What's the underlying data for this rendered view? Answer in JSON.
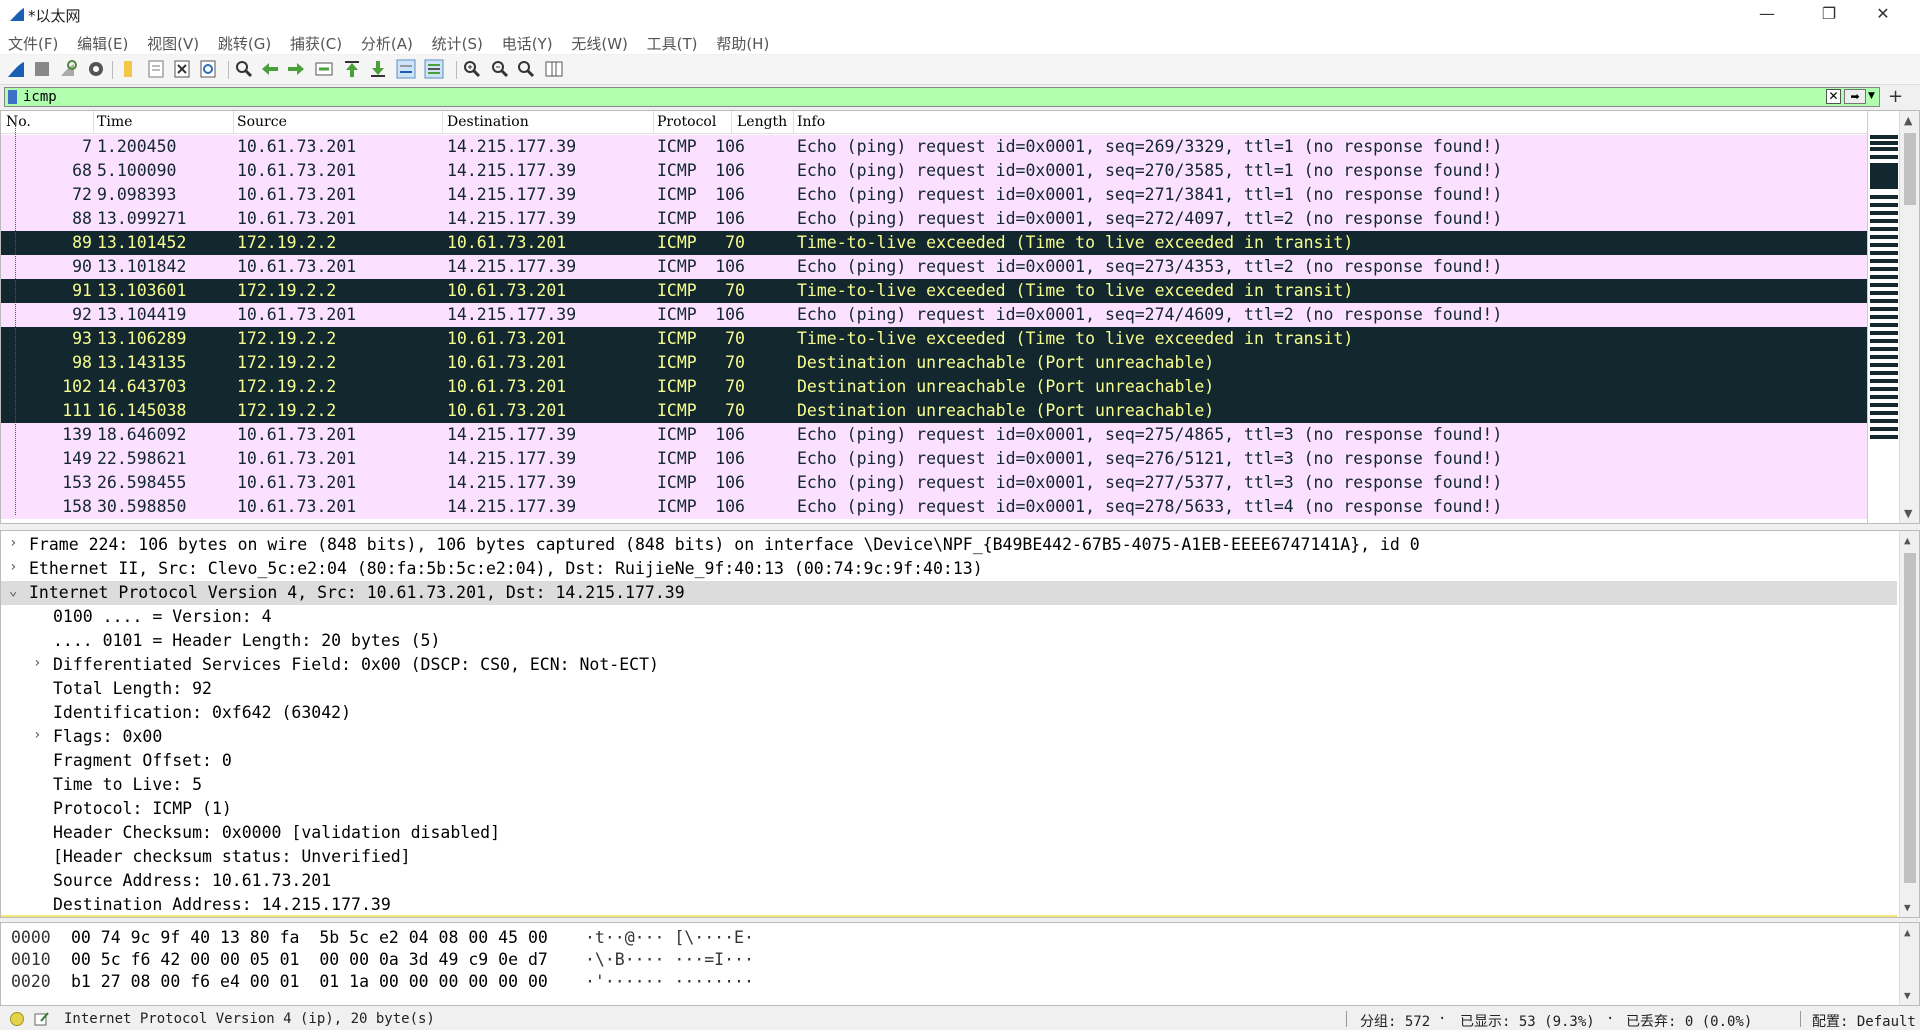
{
  "window": {
    "title": "*以太网",
    "minimize": "—",
    "maximize": "❐",
    "close": "✕"
  },
  "menu": [
    "文件(F)",
    "编辑(E)",
    "视图(V)",
    "跳转(G)",
    "捕获(C)",
    "分析(A)",
    "统计(S)",
    "电话(Y)",
    "无线(W)",
    "工具(T)",
    "帮助(H)"
  ],
  "toolbar_icons": [
    "shark-fin-start-icon",
    "stop-icon",
    "restart-icon",
    "capture-options-icon",
    "open-folder-icon",
    "save-file-icon",
    "close-file-icon",
    "reload-icon",
    "find-icon",
    "go-back-icon",
    "go-forward-icon",
    "go-to-packet-icon",
    "go-first-icon",
    "go-last-icon",
    "autoscroll-icon",
    "colorize-icon",
    "zoom-in-icon",
    "zoom-out-icon",
    "zoom-reset-icon",
    "resize-columns-icon"
  ],
  "filter": {
    "value": "icmp"
  },
  "columns": {
    "no": "No.",
    "time": "Time",
    "source": "Source",
    "destination": "Destination",
    "protocol": "Protocol",
    "length": "Length",
    "info": "Info"
  },
  "packets": [
    {
      "no": "7",
      "time": "1.200450",
      "src": "10.61.73.201",
      "dst": "14.215.177.39",
      "proto": "ICMP",
      "len": "106",
      "info": "Echo (ping) request  id=0x0001, seq=269/3329, ttl=1 (no response found!)",
      "type": "req"
    },
    {
      "no": "68",
      "time": "5.100090",
      "src": "10.61.73.201",
      "dst": "14.215.177.39",
      "proto": "ICMP",
      "len": "106",
      "info": "Echo (ping) request  id=0x0001, seq=270/3585, ttl=1 (no response found!)",
      "type": "req"
    },
    {
      "no": "72",
      "time": "9.098393",
      "src": "10.61.73.201",
      "dst": "14.215.177.39",
      "proto": "ICMP",
      "len": "106",
      "info": "Echo (ping) request  id=0x0001, seq=271/3841, ttl=1 (no response found!)",
      "type": "req"
    },
    {
      "no": "88",
      "time": "13.099271",
      "src": "10.61.73.201",
      "dst": "14.215.177.39",
      "proto": "ICMP",
      "len": "106",
      "info": "Echo (ping) request  id=0x0001, seq=272/4097, ttl=2 (no response found!)",
      "type": "req"
    },
    {
      "no": "89",
      "time": "13.101452",
      "src": "172.19.2.2",
      "dst": "10.61.73.201",
      "proto": "ICMP",
      "len": "70",
      "info": "Time-to-live exceeded (Time to live exceeded in transit)",
      "type": "exc"
    },
    {
      "no": "90",
      "time": "13.101842",
      "src": "10.61.73.201",
      "dst": "14.215.177.39",
      "proto": "ICMP",
      "len": "106",
      "info": "Echo (ping) request  id=0x0001, seq=273/4353, ttl=2 (no response found!)",
      "type": "req"
    },
    {
      "no": "91",
      "time": "13.103601",
      "src": "172.19.2.2",
      "dst": "10.61.73.201",
      "proto": "ICMP",
      "len": "70",
      "info": "Time-to-live exceeded (Time to live exceeded in transit)",
      "type": "exc"
    },
    {
      "no": "92",
      "time": "13.104419",
      "src": "10.61.73.201",
      "dst": "14.215.177.39",
      "proto": "ICMP",
      "len": "106",
      "info": "Echo (ping) request  id=0x0001, seq=274/4609, ttl=2 (no response found!)",
      "type": "req"
    },
    {
      "no": "93",
      "time": "13.106289",
      "src": "172.19.2.2",
      "dst": "10.61.73.201",
      "proto": "ICMP",
      "len": "70",
      "info": "Time-to-live exceeded (Time to live exceeded in transit)",
      "type": "exc"
    },
    {
      "no": "98",
      "time": "13.143135",
      "src": "172.19.2.2",
      "dst": "10.61.73.201",
      "proto": "ICMP",
      "len": "70",
      "info": "Destination unreachable (Port unreachable)",
      "type": "exc"
    },
    {
      "no": "102",
      "time": "14.643703",
      "src": "172.19.2.2",
      "dst": "10.61.73.201",
      "proto": "ICMP",
      "len": "70",
      "info": "Destination unreachable (Port unreachable)",
      "type": "exc"
    },
    {
      "no": "111",
      "time": "16.145038",
      "src": "172.19.2.2",
      "dst": "10.61.73.201",
      "proto": "ICMP",
      "len": "70",
      "info": "Destination unreachable (Port unreachable)",
      "type": "exc"
    },
    {
      "no": "139",
      "time": "18.646092",
      "src": "10.61.73.201",
      "dst": "14.215.177.39",
      "proto": "ICMP",
      "len": "106",
      "info": "Echo (ping) request  id=0x0001, seq=275/4865, ttl=3 (no response found!)",
      "type": "req"
    },
    {
      "no": "149",
      "time": "22.598621",
      "src": "10.61.73.201",
      "dst": "14.215.177.39",
      "proto": "ICMP",
      "len": "106",
      "info": "Echo (ping) request  id=0x0001, seq=276/5121, ttl=3 (no response found!)",
      "type": "req"
    },
    {
      "no": "153",
      "time": "26.598455",
      "src": "10.61.73.201",
      "dst": "14.215.177.39",
      "proto": "ICMP",
      "len": "106",
      "info": "Echo (ping) request  id=0x0001, seq=277/5377, ttl=3 (no response found!)",
      "type": "req"
    },
    {
      "no": "158",
      "time": "30.598850",
      "src": "10.61.73.201",
      "dst": "14.215.177.39",
      "proto": "ICMP",
      "len": "106",
      "info": "Echo (ping) request  id=0x0001, seq=278/5633, ttl=4 (no response found!)",
      "type": "req"
    }
  ],
  "details": [
    {
      "exp": "›",
      "indent": 0,
      "text": "Frame 224: 106 bytes on wire (848 bits), 106 bytes captured (848 bits) on interface \\Device\\NPF_{B49BE442-67B5-4075-A1EB-EEEE6747141A}, id 0"
    },
    {
      "exp": "›",
      "indent": 0,
      "text": "Ethernet II, Src: Clevo_5c:e2:04 (80:fa:5b:5c:e2:04), Dst: RuijieNe_9f:40:13 (00:74:9c:9f:40:13)"
    },
    {
      "exp": "⌄",
      "indent": 0,
      "text": "Internet Protocol Version 4, Src: 10.61.73.201, Dst: 14.215.177.39",
      "selected": true
    },
    {
      "exp": "",
      "indent": 1,
      "text": "0100 .... = Version: 4"
    },
    {
      "exp": "",
      "indent": 1,
      "text": ".... 0101 = Header Length: 20 bytes (5)"
    },
    {
      "exp": "›",
      "indent": 1,
      "text": "Differentiated Services Field: 0x00 (DSCP: CS0, ECN: Not-ECT)"
    },
    {
      "exp": "",
      "indent": 1,
      "text": "Total Length: 92"
    },
    {
      "exp": "",
      "indent": 1,
      "text": "Identification: 0xf642 (63042)"
    },
    {
      "exp": "›",
      "indent": 1,
      "text": "Flags: 0x00"
    },
    {
      "exp": "",
      "indent": 1,
      "text": "Fragment Offset: 0"
    },
    {
      "exp": "",
      "indent": 1,
      "text": "Time to Live: 5"
    },
    {
      "exp": "",
      "indent": 1,
      "text": "Protocol: ICMP (1)"
    },
    {
      "exp": "",
      "indent": 1,
      "text": "Header Checksum: 0x0000 [validation disabled]"
    },
    {
      "exp": "",
      "indent": 1,
      "text": "[Header checksum status: Unverified]"
    },
    {
      "exp": "",
      "indent": 1,
      "text": "Source Address: 10.61.73.201"
    },
    {
      "exp": "",
      "indent": 1,
      "text": "Destination Address: 14.215.177.39"
    }
  ],
  "hex": [
    {
      "off": "0000",
      "bytes": "00 74 9c 9f 40 13 80 fa  5b 5c e2 04 08 00 45 00",
      "ascii": "·t··@··· [\\····E·"
    },
    {
      "off": "0010",
      "bytes": "00 5c f6 42 00 00 05 01  00 00 0a 3d 49 c9 0e d7",
      "ascii": "·\\·B···· ···=I···"
    },
    {
      "off": "0020",
      "bytes": "b1 27 08 00 f6 e4 00 01  01 1a 00 00 00 00 00 00",
      "ascii": "·'······ ········"
    }
  ],
  "status": {
    "field_info": "Internet Protocol Version 4 (ip), 20 byte(s)",
    "packets": "分组: 572",
    "displayed": "已显示: 53 (9.3%)",
    "dropped": "已丢弃: 0 (0.0%)",
    "profile": "配置: Default"
  },
  "colors": {
    "filter_valid": "#afffaf",
    "echo_request_bg": "#fce0ff",
    "icmp_error_bg": "#12272e",
    "icmp_error_fg": "#f7fd8f"
  }
}
